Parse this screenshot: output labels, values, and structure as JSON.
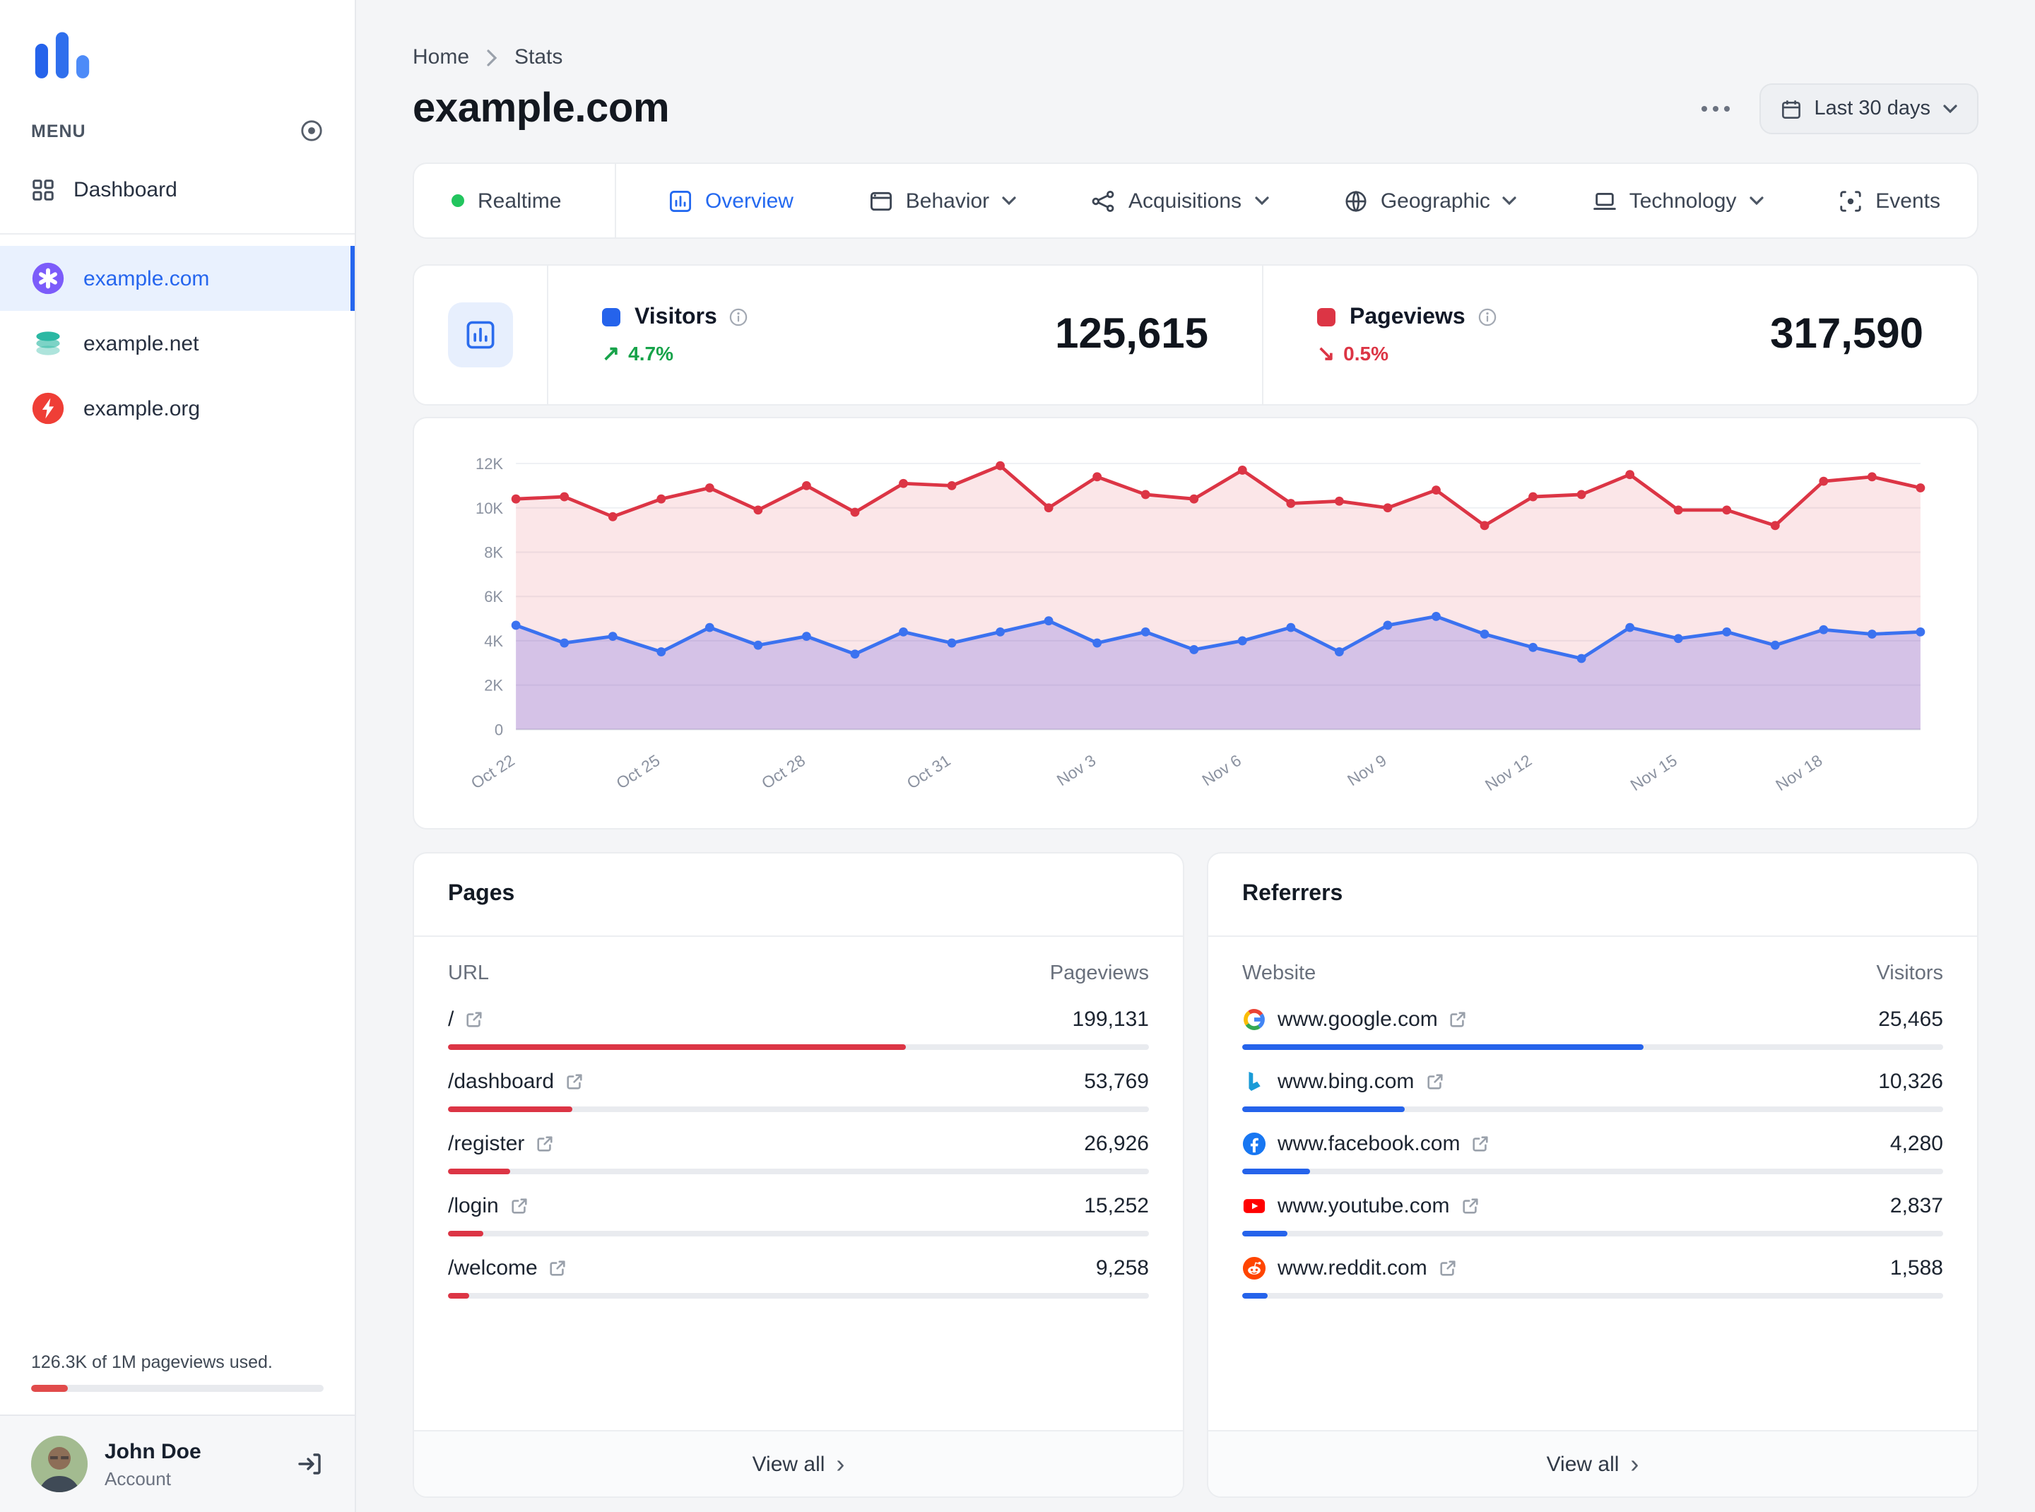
{
  "colors": {
    "blue": "#2563eb",
    "red": "#dc3545",
    "green": "#17a34a",
    "purple_fill": "#4f46e5"
  },
  "sidebar": {
    "menu_label": "MENU",
    "dashboard_label": "Dashboard",
    "sites": [
      {
        "name": "example.com",
        "icon": "purple-asterisk",
        "active": true
      },
      {
        "name": "example.net",
        "icon": "teal-layers",
        "active": false
      },
      {
        "name": "example.org",
        "icon": "red-bolt",
        "active": false
      }
    ],
    "usage": {
      "text": "126.3K of 1M pageviews used.",
      "percent": 12.6
    },
    "account": {
      "name": "John Doe",
      "label": "Account"
    }
  },
  "header": {
    "breadcrumb": [
      "Home",
      "Stats"
    ],
    "title": "example.com",
    "date_range": "Last 30 days"
  },
  "tabs": [
    {
      "label": "Realtime",
      "icon": "realtime",
      "active": false,
      "dropdown": false,
      "divider_after": true
    },
    {
      "label": "Overview",
      "icon": "overview",
      "active": true,
      "dropdown": false
    },
    {
      "label": "Behavior",
      "icon": "behavior",
      "active": false,
      "dropdown": true
    },
    {
      "label": "Acquisitions",
      "icon": "acquisitions",
      "active": false,
      "dropdown": true
    },
    {
      "label": "Geographic",
      "icon": "geographic",
      "active": false,
      "dropdown": true
    },
    {
      "label": "Technology",
      "icon": "technology",
      "active": false,
      "dropdown": true
    },
    {
      "label": "Events",
      "icon": "events",
      "active": false,
      "dropdown": false
    }
  ],
  "stats": {
    "visitors": {
      "label": "Visitors",
      "value": "125,615",
      "delta": "4.7%",
      "direction": "up"
    },
    "pageviews": {
      "label": "Pageviews",
      "value": "317,590",
      "delta": "0.5%",
      "direction": "down"
    }
  },
  "chart_data": {
    "type": "area",
    "title": "Visitors and Pageviews, last 30 days",
    "x": [
      "Oct 22",
      "Oct 23",
      "Oct 24",
      "Oct 25",
      "Oct 26",
      "Oct 27",
      "Oct 28",
      "Oct 29",
      "Oct 30",
      "Oct 31",
      "Nov 1",
      "Nov 2",
      "Nov 3",
      "Nov 4",
      "Nov 5",
      "Nov 6",
      "Nov 7",
      "Nov 8",
      "Nov 9",
      "Nov 10",
      "Nov 11",
      "Nov 12",
      "Nov 13",
      "Nov 14",
      "Nov 15",
      "Nov 16",
      "Nov 17",
      "Nov 18",
      "Nov 19",
      "Nov 20"
    ],
    "tick_every": 3,
    "yticks": [
      "0",
      "2K",
      "4K",
      "6K",
      "8K",
      "10K",
      "12K"
    ],
    "ylim": [
      0,
      12000
    ],
    "grid": true,
    "legend": "none",
    "series": [
      {
        "name": "Pageviews",
        "color": "#dc3545",
        "values": [
          10400,
          10500,
          9600,
          10400,
          10900,
          9900,
          11000,
          9800,
          11100,
          11000,
          11900,
          10000,
          11400,
          10600,
          10400,
          11700,
          10200,
          10300,
          10000,
          10800,
          9200,
          10500,
          10600,
          11500,
          9900,
          9900,
          9200,
          11200,
          11400,
          10900
        ]
      },
      {
        "name": "Visitors",
        "color": "#3b72f0",
        "values": [
          4700,
          3900,
          4200,
          3500,
          4600,
          3800,
          4200,
          3400,
          4400,
          3900,
          4400,
          4900,
          3900,
          4400,
          3600,
          4000,
          4600,
          3500,
          4700,
          5100,
          4300,
          3700,
          3200,
          4600,
          4100,
          4400,
          3800,
          4500,
          4300,
          4400
        ]
      }
    ]
  },
  "pages": {
    "title": "Pages",
    "columns": [
      "URL",
      "Pageviews"
    ],
    "bar_color": "#dc3545",
    "view_all": "View all",
    "rows": [
      {
        "url": "/",
        "value": 199131,
        "display": "199,131"
      },
      {
        "url": "/dashboard",
        "value": 53769,
        "display": "53,769"
      },
      {
        "url": "/register",
        "value": 26926,
        "display": "26,926"
      },
      {
        "url": "/login",
        "value": 15252,
        "display": "15,252"
      },
      {
        "url": "/welcome",
        "value": 9258,
        "display": "9,258"
      }
    ]
  },
  "referrers": {
    "title": "Referrers",
    "columns": [
      "Website",
      "Visitors"
    ],
    "bar_color": "#2563eb",
    "view_all": "View all",
    "rows": [
      {
        "site": "www.google.com",
        "icon": "google",
        "value": 25465,
        "display": "25,465"
      },
      {
        "site": "www.bing.com",
        "icon": "bing",
        "value": 10326,
        "display": "10,326"
      },
      {
        "site": "www.facebook.com",
        "icon": "facebook",
        "value": 4280,
        "display": "4,280"
      },
      {
        "site": "www.youtube.com",
        "icon": "youtube",
        "value": 2837,
        "display": "2,837"
      },
      {
        "site": "www.reddit.com",
        "icon": "reddit",
        "value": 1588,
        "display": "1,588"
      }
    ]
  }
}
